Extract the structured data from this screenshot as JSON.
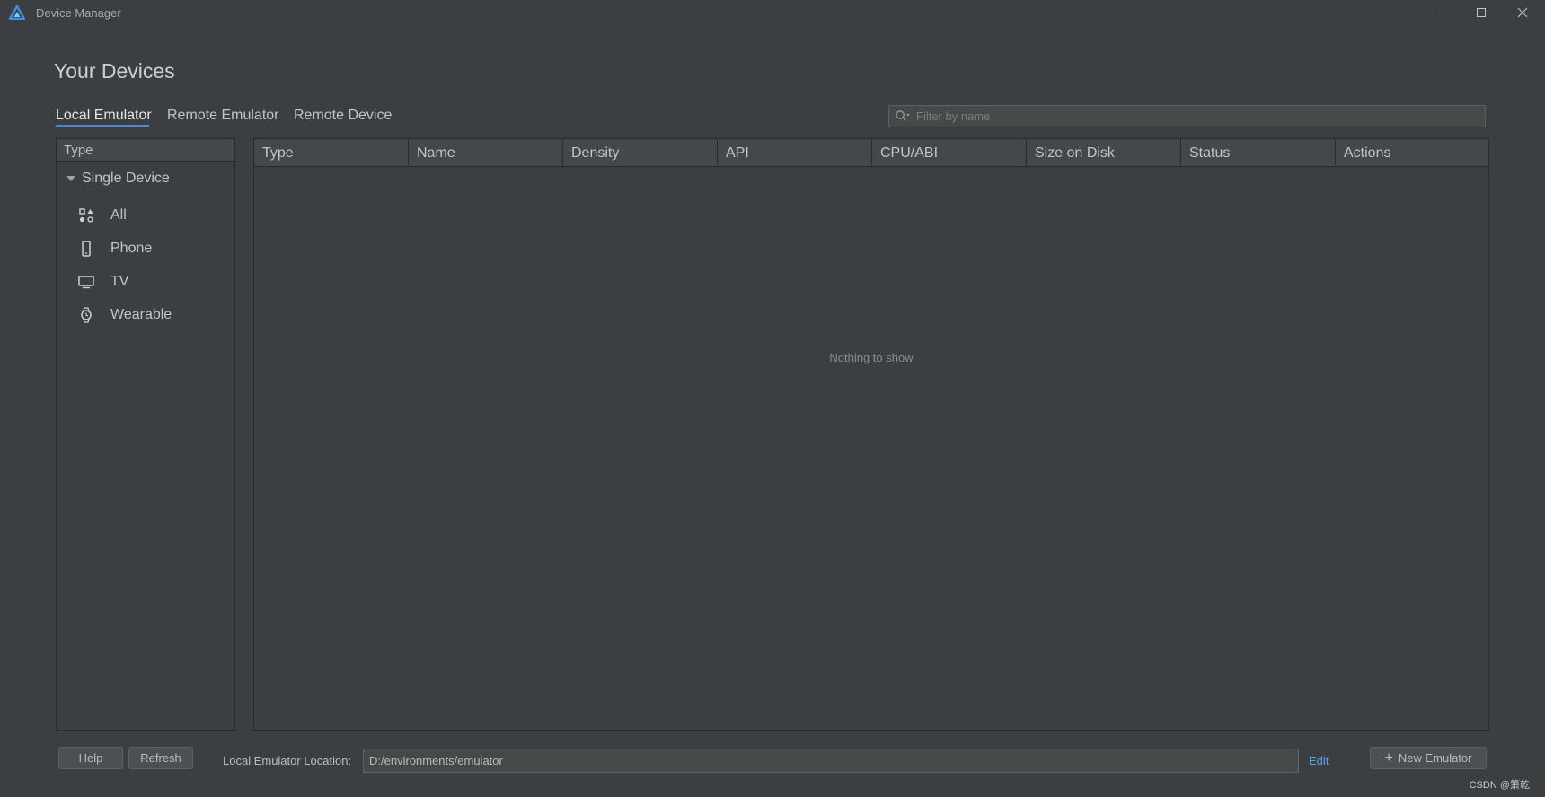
{
  "window": {
    "title": "Device Manager",
    "controls": [
      "minimize-icon",
      "maximize-icon",
      "close-icon"
    ]
  },
  "page": {
    "title": "Your Devices"
  },
  "tabs": [
    {
      "label": "Local Emulator",
      "active": true
    },
    {
      "label": "Remote Emulator",
      "active": false
    },
    {
      "label": "Remote Device",
      "active": false
    }
  ],
  "search": {
    "placeholder": "Filter by name",
    "value": "",
    "icon": "search-icon"
  },
  "sidebar": {
    "header": "Type",
    "group": "Single Device",
    "items": [
      {
        "label": "All",
        "icon": "all-categories-icon"
      },
      {
        "label": "Phone",
        "icon": "phone-icon"
      },
      {
        "label": "TV",
        "icon": "tv-icon"
      },
      {
        "label": "Wearable",
        "icon": "watch-icon"
      }
    ]
  },
  "table": {
    "columns": [
      "Type",
      "Name",
      "Density",
      "API",
      "CPU/ABI",
      "Size on Disk",
      "Status",
      "Actions"
    ],
    "rows": [],
    "empty_text": "Nothing to show"
  },
  "footer": {
    "help_label": "Help",
    "refresh_label": "Refresh",
    "location_label": "Local Emulator Location:",
    "location_value": "D:/environments/emulator",
    "edit_label": "Edit",
    "new_emulator_label": "New Emulator"
  },
  "watermark": "CSDN @箫乾",
  "colors": {
    "background": "#3c3f41",
    "header_background": "#45484a",
    "accent": "#4a88c7",
    "link": "#589df6"
  }
}
